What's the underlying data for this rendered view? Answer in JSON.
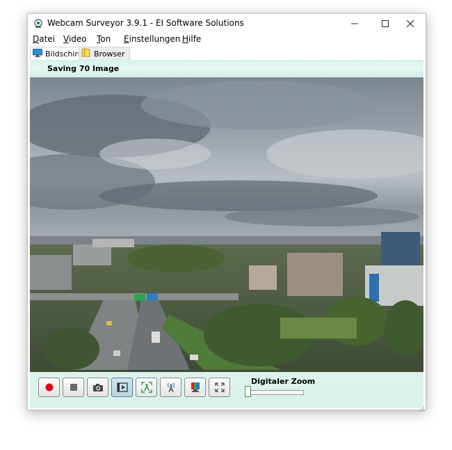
{
  "window": {
    "title": "Webcam Surveyor 3.9.1 - EI Software Solutions",
    "controls": [
      "minimize-icon",
      "maximize-icon",
      "close-icon"
    ]
  },
  "menu": [
    {
      "label": "Datei",
      "accel": "D",
      "rest": "atei"
    },
    {
      "label": "Video",
      "accel": "V",
      "rest": "ideo"
    },
    {
      "label": "Ton",
      "accel": "T",
      "rest": "on"
    },
    {
      "label": "Einstellungen",
      "accel": "E",
      "rest": "instellungen"
    },
    {
      "label": "Hilfe",
      "accel": "H",
      "rest": "ilfe"
    }
  ],
  "tabs": [
    {
      "label": "Bildschirm",
      "icon": "monitor-icon",
      "active": true
    },
    {
      "label": "Browser",
      "icon": "folder-icon",
      "active": false
    }
  ],
  "status": {
    "text": "Saving 70 Image"
  },
  "toolbar": {
    "buttons": [
      {
        "name": "record-button",
        "icon": "record-icon",
        "pressed": false
      },
      {
        "name": "stop-button",
        "icon": "stop-icon",
        "pressed": false
      },
      {
        "name": "snapshot-button",
        "icon": "camera-icon",
        "pressed": false
      },
      {
        "name": "playback-button",
        "icon": "playback-icon",
        "pressed": true
      },
      {
        "name": "motion-detect-button",
        "icon": "motion-detect-icon",
        "pressed": false
      },
      {
        "name": "broadcast-button",
        "icon": "broadcast-icon",
        "pressed": false
      },
      {
        "name": "color-settings-button",
        "icon": "color-icon",
        "pressed": false
      },
      {
        "name": "fullscreen-button",
        "icon": "fullscreen-icon",
        "pressed": false
      }
    ],
    "zoom_label": "Digitaler Zoom",
    "zoom_value": 0
  },
  "colors": {
    "record": "#e0001b",
    "panel": "#e1f5ef",
    "status_bar": "#d6f1ea"
  }
}
